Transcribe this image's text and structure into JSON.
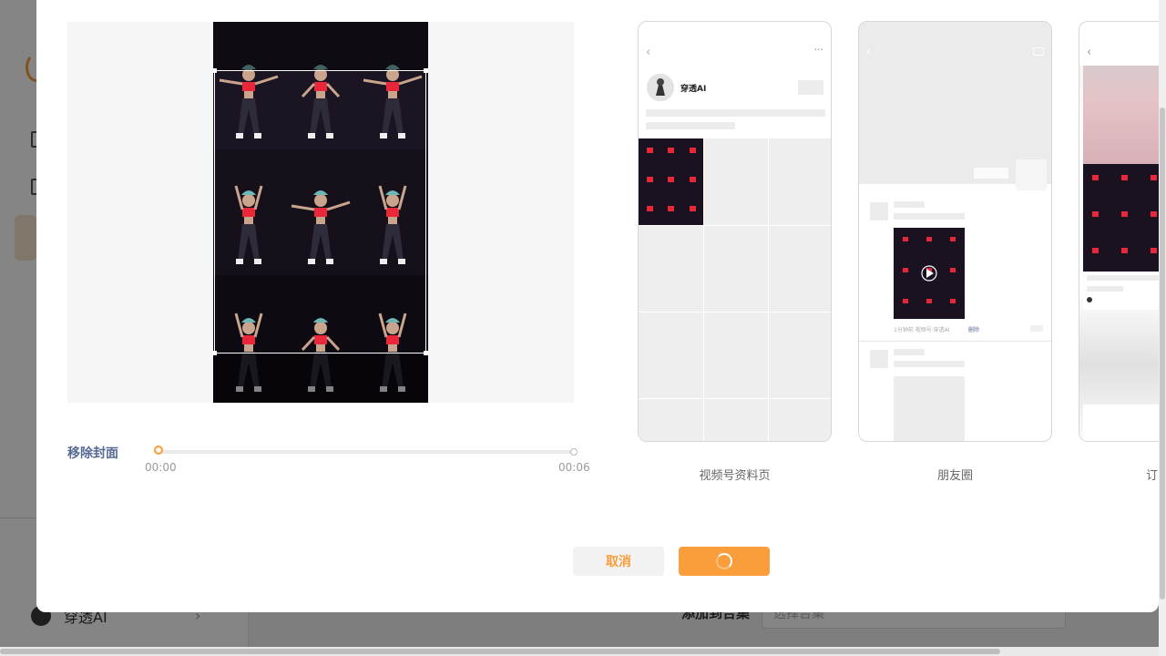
{
  "background": {
    "account_name": "穿透AI",
    "form_label": "添加到合集",
    "select_placeholder": "选择合集"
  },
  "editor": {
    "remove_cover_label": "移除封面",
    "time_start": "00:00",
    "time_end": "00:06"
  },
  "previews": [
    {
      "label": "视频号资料页"
    },
    {
      "label": "朋友圈"
    },
    {
      "label": "订阅号消息"
    }
  ],
  "profile_preview": {
    "account_name": "穿透AI",
    "more_icon_text": "···"
  },
  "moments_preview": {
    "meta_text": "1分钟前  视频号·穿透AI",
    "delete_text": "删除"
  },
  "actions": {
    "cancel_label": "取消"
  },
  "colors": {
    "accent": "#fa9d3b",
    "link": "#576b95"
  }
}
